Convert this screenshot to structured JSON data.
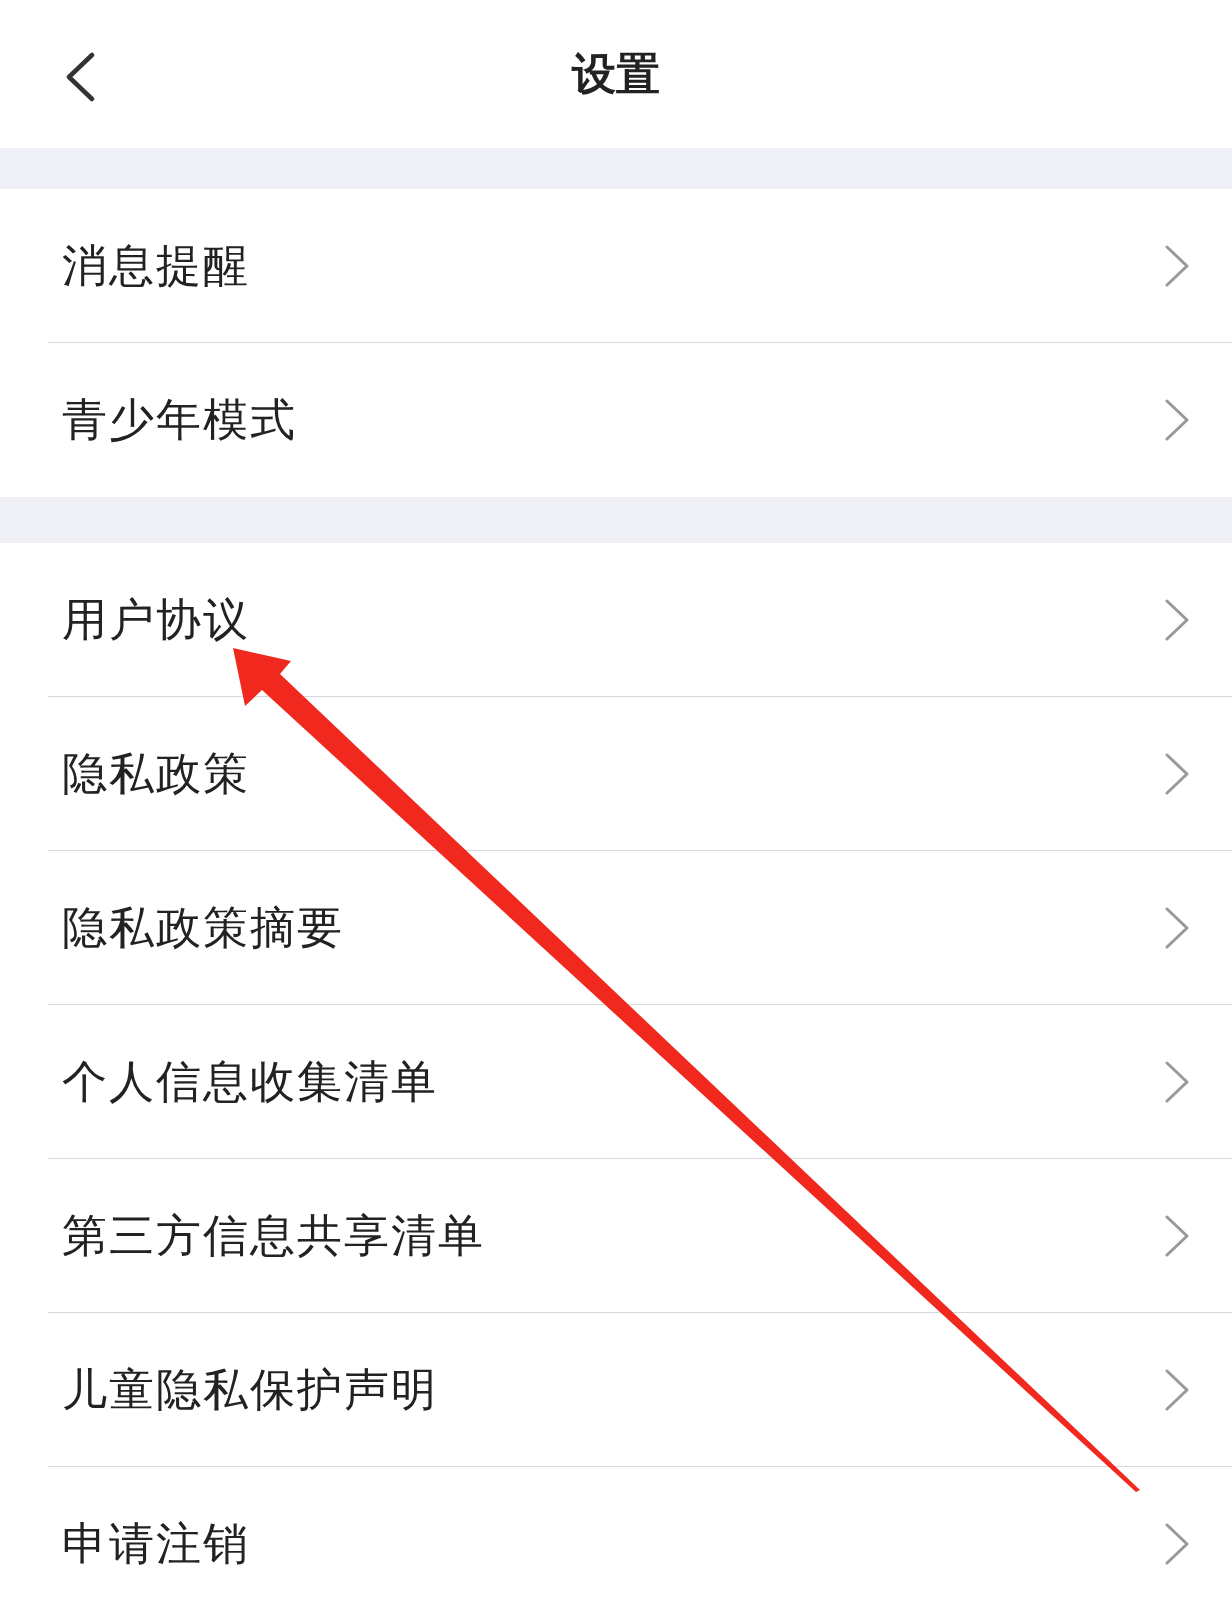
{
  "header": {
    "title": "设置"
  },
  "sections": [
    {
      "items": [
        {
          "label": "消息提醒"
        },
        {
          "label": "青少年模式"
        }
      ]
    },
    {
      "items": [
        {
          "label": "用户协议"
        },
        {
          "label": "隐私政策"
        },
        {
          "label": "隐私政策摘要"
        },
        {
          "label": "个人信息收集清单"
        },
        {
          "label": "第三方信息共享清单"
        },
        {
          "label": "儿童隐私保护声明"
        },
        {
          "label": "申请注销"
        }
      ]
    }
  ]
}
